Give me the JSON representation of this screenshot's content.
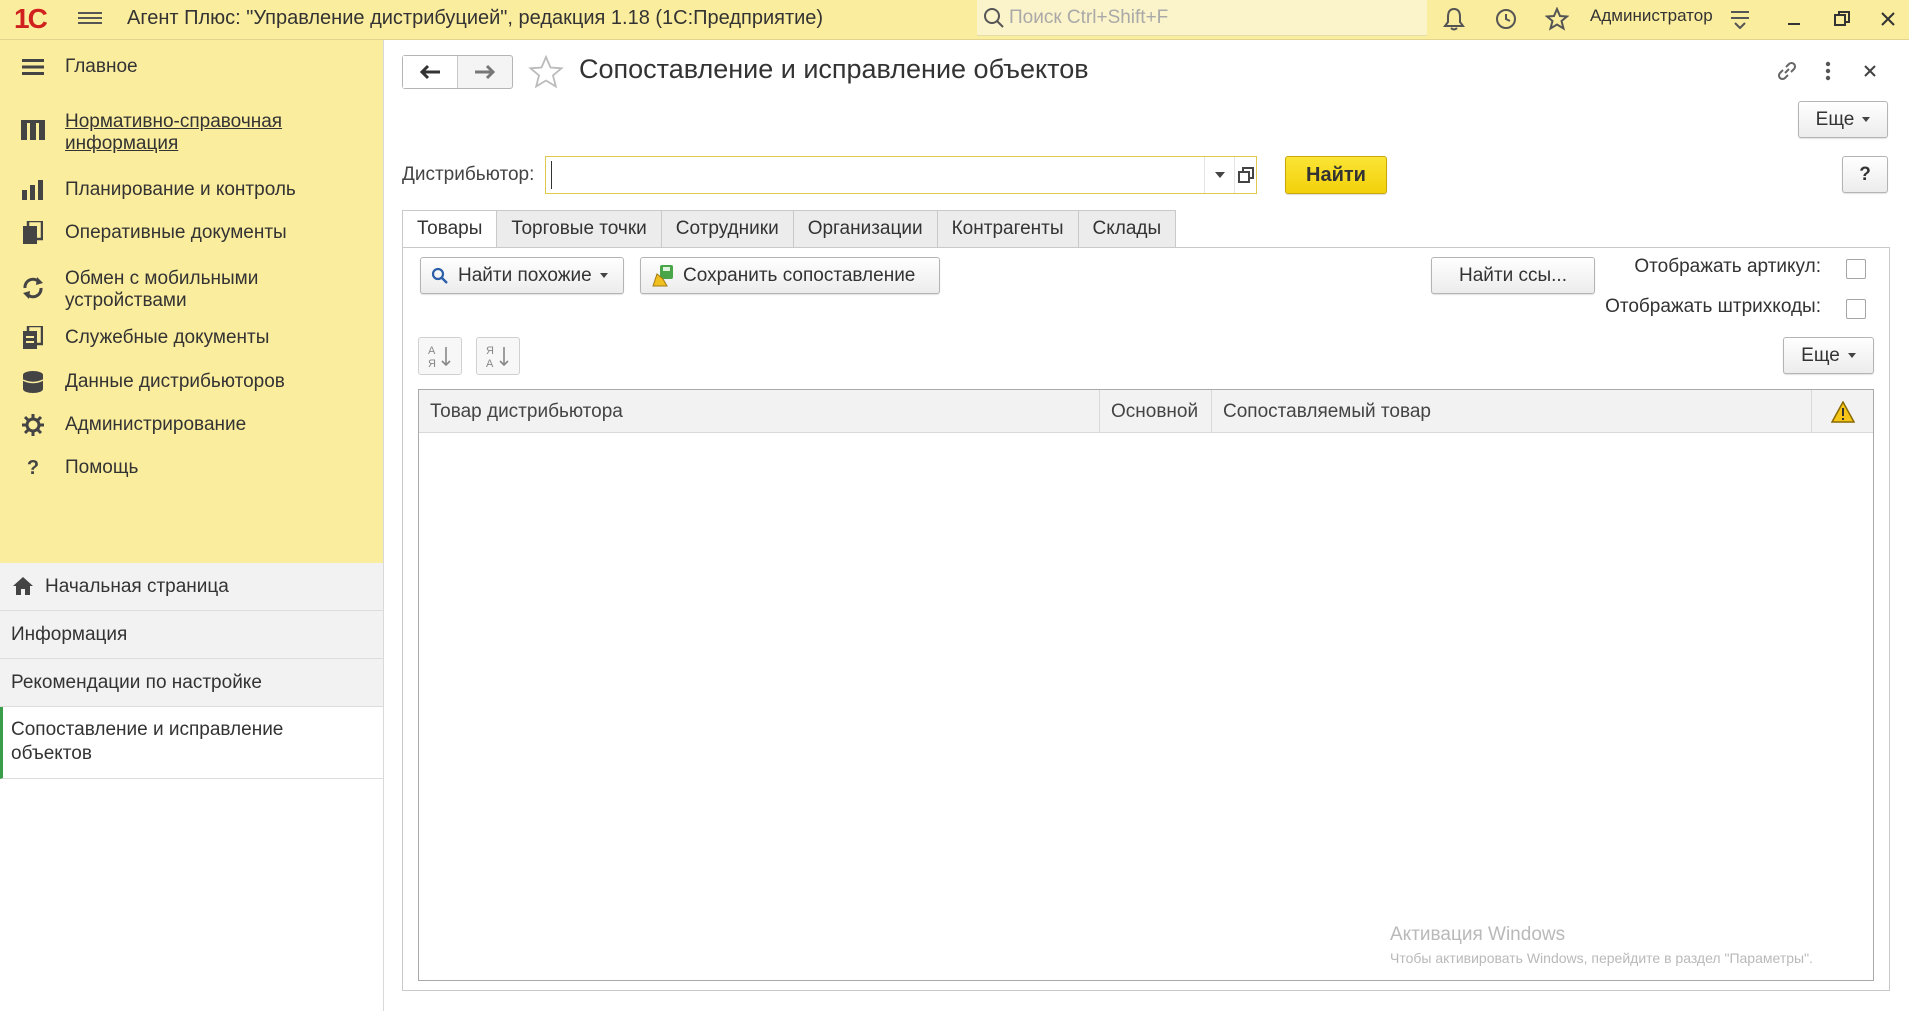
{
  "app": {
    "logo_text": "1С",
    "title": "Агент Плюс: \"Управление дистрибуцией\", редакция 1.18  (1С:Предприятие)",
    "search_placeholder": "Поиск Ctrl+Shift+F",
    "username": "Администратор"
  },
  "sidebar": {
    "sections": [
      {
        "label": "Главное",
        "icon": "menu-icon"
      },
      {
        "label": "Нормативно-справочная информация",
        "icon": "catalog-icon"
      },
      {
        "label": "Планирование и контроль",
        "icon": "bar-chart-icon"
      },
      {
        "label": "Оперативные документы",
        "icon": "documents-icon"
      },
      {
        "label": "Обмен с мобильными устройствами",
        "icon": "sync-icon"
      },
      {
        "label": "Служебные документы",
        "icon": "service-documents-icon"
      },
      {
        "label": "Данные дистрибьюторов",
        "icon": "database-icon"
      },
      {
        "label": "Администрирование",
        "icon": "gear-icon"
      },
      {
        "label": "Помощь",
        "icon": "help-icon"
      }
    ],
    "open_windows": [
      {
        "label": "Начальная страница",
        "icon": "home-icon"
      },
      {
        "label": "Информация"
      },
      {
        "label": "Рекомендации по настройке"
      },
      {
        "label": "Сопоставление и исправление объектов",
        "active": true
      }
    ]
  },
  "form": {
    "title": "Сопоставление и исправление объектов",
    "more_label": "Еще",
    "help_label": "?",
    "distributor_label": "Дистрибьютор:",
    "distributor_value": "",
    "find_label": "Найти",
    "tabs": [
      "Товары",
      "Торговые точки",
      "Сотрудники",
      "Организации",
      "Контрагенты",
      "Склады"
    ],
    "active_tab": "Товары",
    "find_similar_label": "Найти похожие",
    "save_mapping_label": "Сохранить сопоставление",
    "find_refs_label": "Найти ссы...",
    "show_article_label": "Отображать артикул:",
    "show_barcodes_label": "Отображать штрихкоды:",
    "show_article_checked": false,
    "show_barcodes_checked": false,
    "table_more_label": "Еще",
    "columns": [
      "Товар дистрибьютора",
      "Основной",
      "Сопоставляемый товар"
    ],
    "rows": []
  },
  "watermark": {
    "line1": "Активация Windows",
    "line2": "Чтобы активировать Windows, перейдите в раздел \"Параметры\"."
  },
  "colors": {
    "topbar_bg": "#fbed9e",
    "sidebar_bg": "#fbed9e",
    "primary_button": "#f5d80f",
    "active_marker": "#3a9d4a",
    "logo": "#d0211f"
  }
}
